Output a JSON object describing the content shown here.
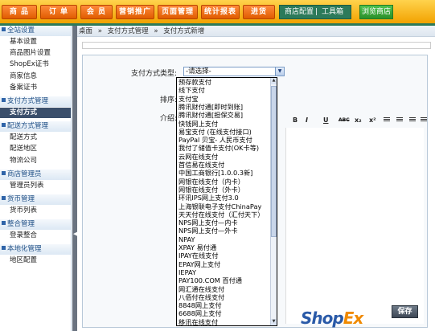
{
  "topnav": {
    "tabs": [
      "商 品",
      "订 单",
      "会 员",
      "营销推广",
      "页面管理",
      "统计报表",
      "进货"
    ],
    "store_config": "商店配置",
    "separator": "|",
    "toolbox": "工具箱",
    "browse_store": "浏览商店"
  },
  "sidebar": {
    "groups": [
      {
        "title": "全站设置",
        "items": [
          "基本设置",
          "商品图片设置",
          "ShopEx证书",
          "商家信息",
          "备案证书"
        ]
      },
      {
        "title": "支付方式管理",
        "items": [
          "支付方式"
        ]
      },
      {
        "title": "配送方式管理",
        "items": [
          "配送方式",
          "配送地区",
          "物流公司"
        ]
      },
      {
        "title": "商店管理员",
        "items": [
          "管理员列表"
        ]
      },
      {
        "title": "货币管理",
        "items": [
          "货币列表"
        ]
      },
      {
        "title": "整合管理",
        "items": [
          "登录整合"
        ]
      },
      {
        "title": "本地化管理",
        "items": [
          "地区配置"
        ]
      }
    ],
    "active_item": "支付方式"
  },
  "breadcrumb": [
    "桌面",
    "»",
    "支付方式管理",
    "»",
    "支付方式新增"
  ],
  "form": {
    "payment_type_label": "支付方式类型:",
    "sort_label": "排序:",
    "intro_label": "介绍:",
    "select_value": "-请选择-"
  },
  "editor_buttons": [
    "B",
    "I",
    "U",
    "ABC",
    "x₂",
    "x²"
  ],
  "dropdown_options": [
    "预存款支付",
    "线下支付",
    "支付宝",
    "腾讯财付通[即时到账]",
    "腾讯财付通[担保交易]",
    "快钱网上支付",
    "易宝支付 (在线支付接口)",
    "PayPal 贝宝- 人民币支付",
    "我付了储值卡支付(OK卡等)",
    "云网在线支付",
    "首信易在线支付",
    "中国工商银行[1.0.0.3新]",
    "网银在线支付（内卡）",
    "网银在线支付（外卡）",
    "环讯IPS网上支付3.0",
    "上海银联电子支付ChinaPay",
    "天天付在线支付（汇付天下）",
    "NPS网上支付—内卡",
    "NPS网上支付—外卡",
    "NPAY",
    "XPAY 易付通",
    "IPAY在线支付",
    "EPAY网上支付",
    "IEPAY",
    "PAY100.COM 百付通",
    "网汇通在线支付",
    "八佰付在线支付",
    "8848网上支付",
    "6688网上支付",
    "移讯在线支付"
  ],
  "footer": {
    "logo_shop": "Shop",
    "logo_ex": "Ex",
    "save": "保存"
  },
  "colors": {
    "nav_orange": "#f2a200",
    "nav_green": "#2c7a5a",
    "sidebar_active": "#3b4f6b",
    "link_blue": "#1f4f86"
  }
}
